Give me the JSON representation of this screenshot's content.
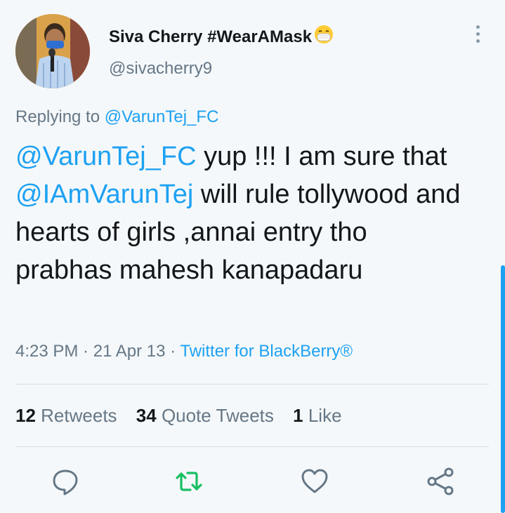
{
  "author": {
    "name": "Siva Cherry #WearAMask",
    "handle": "@sivacherry9"
  },
  "reply": {
    "prefix": "Replying to",
    "to": "@VarunTej_FC"
  },
  "tweet": {
    "mention1": "@VarunTej_FC",
    "text1": " yup !!! I am sure that ",
    "mention2": "@IAmVarunTej",
    "text2": " will rule tollywood and hearts of girls ,annai entry tho prabhas mahesh kanapadaru"
  },
  "meta": {
    "time": "4:23 PM",
    "sep": " · ",
    "date": "21 Apr 13",
    "sep2": " · ",
    "source": "Twitter for BlackBerry®"
  },
  "stats": {
    "retweets_count": "12",
    "retweets_label": "Retweets",
    "quotes_count": "34",
    "quotes_label": "Quote Tweets",
    "likes_count": "1",
    "likes_label": "Like"
  },
  "icons": {
    "reply": "reply-icon",
    "retweet": "retweet-icon",
    "like": "heart-icon",
    "share": "share-icon",
    "more": "more-icon"
  },
  "colors": {
    "accent": "#1da1f2",
    "retweet": "#17bf63",
    "muted": "#657786",
    "background": "#f5f8fa"
  }
}
